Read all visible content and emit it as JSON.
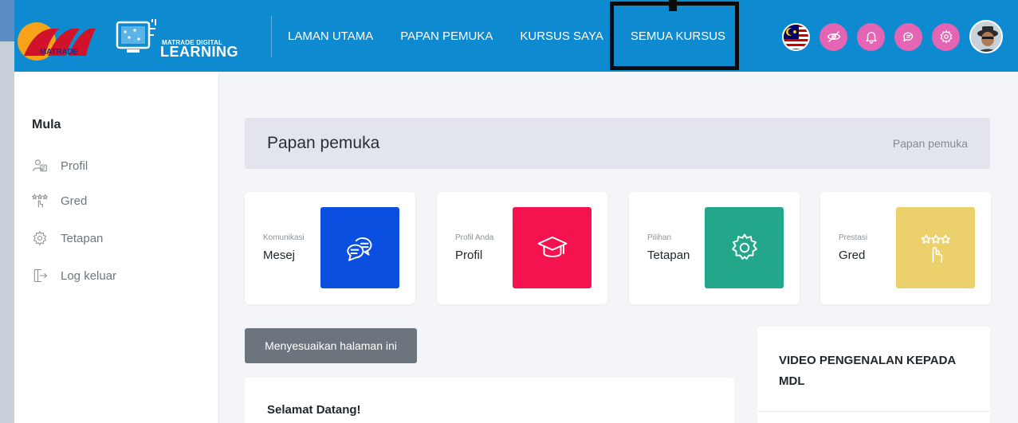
{
  "header": {
    "logo_text": "MATRADE",
    "mdl_logo_small": "MATRADE DIGITAL",
    "mdl_logo_big": "LEARNING",
    "nav": [
      {
        "label": "LAMAN UTAMA"
      },
      {
        "label": "PAPAN PEMUKA"
      },
      {
        "label": "KURSUS SAYA"
      },
      {
        "label": "SEMUA KURSUS",
        "highlighted": true
      }
    ],
    "icons": [
      "malaysia-flag-icon",
      "eye-slash-icon",
      "bell-icon",
      "chat-icon",
      "gear-icon",
      "user-avatar"
    ],
    "bg_color": "#0e8ad1",
    "icon_color": "#e465b3"
  },
  "sidebar": {
    "heading": "Mula",
    "items": [
      {
        "label": "Profil",
        "icon": "profile-icon"
      },
      {
        "label": "Gred",
        "icon": "grade-icon"
      },
      {
        "label": "Tetapan",
        "icon": "gear-icon"
      },
      {
        "label": "Log keluar",
        "icon": "logout-icon"
      }
    ]
  },
  "main": {
    "page_title": "Papan pemuka",
    "breadcrumb": "Papan pemuka",
    "cards": [
      {
        "subtitle": "Komunikasi",
        "title": "Mesej",
        "color": "#0b4fe0",
        "icon": "chat-bubbles-icon"
      },
      {
        "subtitle": "Profil Anda",
        "title": "Profil",
        "color": "#f5134f",
        "icon": "graduation-cap-icon"
      },
      {
        "subtitle": "Pilihan",
        "title": "Tetapan",
        "color": "#22a78b",
        "icon": "gear-icon"
      },
      {
        "subtitle": "Prestasi",
        "title": "Gred",
        "color": "#ecd06b",
        "icon": "stars-hand-icon"
      }
    ],
    "customize_button": "Menyesuaikan halaman ini",
    "welcome_title": "Selamat Datang!",
    "video_title": "VIDEO PENGENALAN KEPADA MDL"
  }
}
